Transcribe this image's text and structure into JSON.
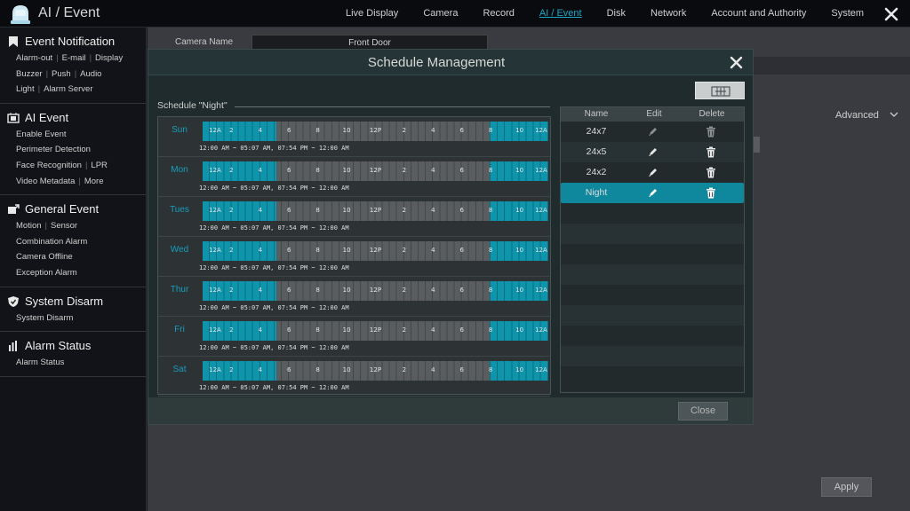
{
  "app": {
    "title": "AI / Event"
  },
  "nav": {
    "items": [
      "Live Display",
      "Camera",
      "Record",
      "AI / Event",
      "Disk",
      "Network",
      "Account and Authority",
      "System"
    ],
    "active": "AI / Event"
  },
  "sidebar": {
    "groups": [
      {
        "title": "Event Notification",
        "icon": "bookmark-icon",
        "rows": [
          [
            "Alarm-out",
            "E-mail",
            "Display"
          ],
          [
            "Buzzer",
            "Push",
            "Audio"
          ],
          [
            "Light",
            "Alarm Server"
          ]
        ]
      },
      {
        "title": "AI Event",
        "icon": "ai-chip-icon",
        "rows": [
          [
            "Enable Event"
          ],
          [
            "Perimeter Detection"
          ],
          [
            "Face Recognition",
            "LPR"
          ],
          [
            "Video Metadata",
            "More"
          ]
        ]
      },
      {
        "title": "General Event",
        "icon": "general-event-icon",
        "rows": [
          [
            "Motion",
            "Sensor"
          ],
          [
            "Combination Alarm"
          ],
          [
            "Camera Offline"
          ],
          [
            "Exception Alarm"
          ]
        ]
      },
      {
        "title": "System Disarm",
        "icon": "shield-icon",
        "rows": [
          [
            "System Disarm"
          ]
        ]
      },
      {
        "title": "Alarm Status",
        "icon": "alarm-status-icon",
        "rows": [
          [
            "Alarm Status"
          ]
        ]
      }
    ]
  },
  "background_page": {
    "camera_name_label": "Camera Name",
    "camera_name_value": "Front Door",
    "advanced_label": "Advanced",
    "apply_label": "Apply"
  },
  "modal": {
    "title": "Schedule Management",
    "schedule_caption": "Schedule \"Night\"",
    "close_label": "Close",
    "add_button_icon": "add-schedule-icon",
    "timeline_labels": [
      "12A",
      "2",
      "4",
      "6",
      "8",
      "10",
      "12P",
      "2",
      "4",
      "6",
      "8",
      "10",
      "12A"
    ],
    "days": [
      {
        "name": "Sun",
        "times": "12:00 AM ~ 05:07 AM,   07:54 PM ~ 12:00 AM"
      },
      {
        "name": "Mon",
        "times": "12:00 AM ~ 05:07 AM,   07:54 PM ~ 12:00 AM"
      },
      {
        "name": "Tues",
        "times": "12:00 AM ~ 05:07 AM,   07:54 PM ~ 12:00 AM"
      },
      {
        "name": "Wed",
        "times": "12:00 AM ~ 05:07 AM,   07:54 PM ~ 12:00 AM"
      },
      {
        "name": "Thur",
        "times": "12:00 AM ~ 05:07 AM,   07:54 PM ~ 12:00 AM"
      },
      {
        "name": "Fri",
        "times": "12:00 AM ~ 05:07 AM,   07:54 PM ~ 12:00 AM"
      },
      {
        "name": "Sat",
        "times": "12:00 AM ~ 05:07 AM,   07:54 PM ~ 12:00 AM"
      }
    ],
    "active_ranges_hours": [
      [
        0,
        5.1167
      ],
      [
        19.9,
        24
      ]
    ],
    "table": {
      "headers": [
        "Name",
        "Edit",
        "Delete"
      ],
      "rows": [
        {
          "name": "24x7",
          "editable": false,
          "selected": false
        },
        {
          "name": "24x5",
          "editable": true,
          "selected": false
        },
        {
          "name": "24x2",
          "editable": true,
          "selected": false
        },
        {
          "name": "Night",
          "editable": true,
          "selected": true
        }
      ]
    }
  },
  "colors": {
    "accent": "#0e94ab",
    "active_nav": "#1aa6c4",
    "selected_row": "#0f889e"
  }
}
